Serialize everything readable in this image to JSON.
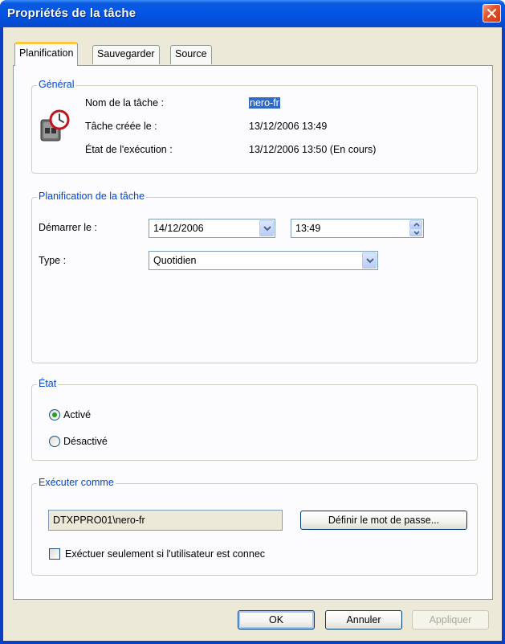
{
  "window": {
    "title": "Propriétés de la tâche"
  },
  "tabs": [
    {
      "label": "Planification",
      "active": true
    },
    {
      "label": "Sauvegarder",
      "active": false
    },
    {
      "label": "Source",
      "active": false
    }
  ],
  "general": {
    "legend": "Général",
    "name_label": "Nom de la tâche :",
    "name_value": "nero-fr",
    "created_label": "Tâche créée le :",
    "created_value": "13/12/2006 13:49",
    "state_label": "État de l'exécution :",
    "state_value": "13/12/2006 13:50 (En cours)",
    "icon": "task-scheduler-icon"
  },
  "schedule": {
    "legend": "Planification de la tâche",
    "start_label": "Démarrer le :",
    "start_date": "14/12/2006",
    "start_time": "13:49",
    "type_label": "Type :",
    "type_value": "Quotidien"
  },
  "state": {
    "legend": "État",
    "option_enabled": "Activé",
    "option_disabled": "Désactivé",
    "selected": "Activé"
  },
  "run_as": {
    "legend": "Exécuter comme",
    "account": "DTXPPRO01\\nero-fr",
    "set_password_label": "Définir le mot de passe...",
    "only_if_logged_on_label": "Exéctuer seulement si l'utilisateur est connec",
    "only_if_logged_on_checked": false
  },
  "footer": {
    "ok_label": "OK",
    "cancel_label": "Annuler",
    "apply_label": "Appliquer"
  },
  "colors": {
    "title_bar": "#0456e4",
    "group_legend": "#0046d5",
    "close_button": "#e0552e",
    "selection": "#316ac5"
  }
}
